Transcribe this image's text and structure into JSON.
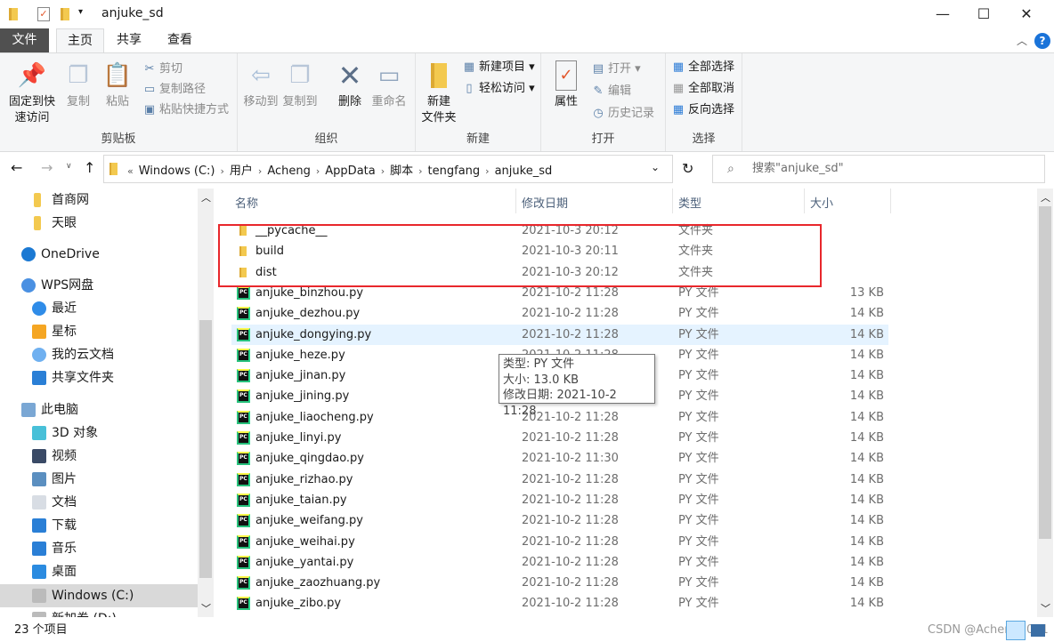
{
  "window": {
    "title": "anjuke_sd",
    "minimize": "—",
    "maximize": "☐",
    "close": "✕"
  },
  "ribbon_tabs": [
    "文件",
    "主页",
    "共享",
    "查看"
  ],
  "ribbon": {
    "clipboard": {
      "label": "剪贴板",
      "pin": "固定到快速访问",
      "copy": "复制",
      "paste": "粘贴",
      "cut": "剪切",
      "copy_path": "复制路径",
      "paste_shortcut": "粘贴快捷方式"
    },
    "organize": {
      "label": "组织",
      "move_to": "移动到",
      "copy_to": "复制到",
      "delete": "删除",
      "rename": "重命名"
    },
    "new": {
      "label": "新建",
      "new_folder": "新建\n文件夹",
      "new_item": "新建项目",
      "easy_access": "轻松访问"
    },
    "open": {
      "label": "打开",
      "properties": "属性",
      "open": "打开",
      "edit": "编辑",
      "history": "历史记录"
    },
    "select": {
      "label": "选择",
      "select_all": "全部选择",
      "select_none": "全部取消",
      "invert": "反向选择"
    }
  },
  "address": {
    "crumbs": [
      "Windows (C:)",
      "用户",
      "Acheng",
      "AppData",
      "脚本",
      "tengfang",
      "anjuke_sd"
    ],
    "search_placeholder": "搜索\"anjuke_sd\""
  },
  "nav": [
    {
      "label": "首商网",
      "icon": "folder-icon"
    },
    {
      "label": "天眼",
      "icon": "folder-icon"
    },
    {
      "label": "OneDrive",
      "icon": "cloud-icon"
    },
    {
      "label": "WPS网盘",
      "icon": "wps-cloud-icon"
    },
    {
      "label": "最近",
      "icon": "clock-icon"
    },
    {
      "label": "星标",
      "icon": "star-icon"
    },
    {
      "label": "我的云文档",
      "icon": "cloud-doc-icon"
    },
    {
      "label": "共享文件夹",
      "icon": "share-icon"
    },
    {
      "label": "此电脑",
      "icon": "computer-icon"
    },
    {
      "label": "3D 对象",
      "icon": "3d-icon"
    },
    {
      "label": "视频",
      "icon": "video-icon"
    },
    {
      "label": "图片",
      "icon": "picture-icon"
    },
    {
      "label": "文档",
      "icon": "document-icon"
    },
    {
      "label": "下载",
      "icon": "download-icon"
    },
    {
      "label": "音乐",
      "icon": "music-icon"
    },
    {
      "label": "桌面",
      "icon": "desktop-icon"
    },
    {
      "label": "Windows (C:)",
      "icon": "drive-icon"
    },
    {
      "label": "新加卷 (D:)",
      "icon": "drive-icon"
    }
  ],
  "columns": [
    "名称",
    "修改日期",
    "类型",
    "大小"
  ],
  "files": [
    {
      "name": "__pycache__",
      "date": "2021-10-3 20:12",
      "type": "文件夹",
      "size": "",
      "kind": "folder"
    },
    {
      "name": "build",
      "date": "2021-10-3 20:11",
      "type": "文件夹",
      "size": "",
      "kind": "folder"
    },
    {
      "name": "dist",
      "date": "2021-10-3 20:12",
      "type": "文件夹",
      "size": "",
      "kind": "folder"
    },
    {
      "name": "anjuke_binzhou.py",
      "date": "2021-10-2 11:28",
      "type": "PY 文件",
      "size": "13 KB",
      "kind": "py"
    },
    {
      "name": "anjuke_dezhou.py",
      "date": "2021-10-2 11:28",
      "type": "PY 文件",
      "size": "14 KB",
      "kind": "py"
    },
    {
      "name": "anjuke_dongying.py",
      "date": "2021-10-2 11:28",
      "type": "PY 文件",
      "size": "14 KB",
      "kind": "py"
    },
    {
      "name": "anjuke_heze.py",
      "date": "2021-10-2 11:28",
      "type": "PY 文件",
      "size": "14 KB",
      "kind": "py"
    },
    {
      "name": "anjuke_jinan.py",
      "date": "2021-10-2 11:28",
      "type": "PY 文件",
      "size": "14 KB",
      "kind": "py"
    },
    {
      "name": "anjuke_jining.py",
      "date": "2021-10-2 11:28",
      "type": "PY 文件",
      "size": "14 KB",
      "kind": "py"
    },
    {
      "name": "anjuke_liaocheng.py",
      "date": "2021-10-2 11:28",
      "type": "PY 文件",
      "size": "14 KB",
      "kind": "py"
    },
    {
      "name": "anjuke_linyi.py",
      "date": "2021-10-2 11:28",
      "type": "PY 文件",
      "size": "14 KB",
      "kind": "py"
    },
    {
      "name": "anjuke_qingdao.py",
      "date": "2021-10-2 11:30",
      "type": "PY 文件",
      "size": "14 KB",
      "kind": "py"
    },
    {
      "name": "anjuke_rizhao.py",
      "date": "2021-10-2 11:28",
      "type": "PY 文件",
      "size": "14 KB",
      "kind": "py"
    },
    {
      "name": "anjuke_taian.py",
      "date": "2021-10-2 11:28",
      "type": "PY 文件",
      "size": "14 KB",
      "kind": "py"
    },
    {
      "name": "anjuke_weifang.py",
      "date": "2021-10-2 11:28",
      "type": "PY 文件",
      "size": "14 KB",
      "kind": "py"
    },
    {
      "name": "anjuke_weihai.py",
      "date": "2021-10-2 11:28",
      "type": "PY 文件",
      "size": "14 KB",
      "kind": "py"
    },
    {
      "name": "anjuke_yantai.py",
      "date": "2021-10-2 11:28",
      "type": "PY 文件",
      "size": "14 KB",
      "kind": "py"
    },
    {
      "name": "anjuke_zaozhuang.py",
      "date": "2021-10-2 11:28",
      "type": "PY 文件",
      "size": "14 KB",
      "kind": "py"
    },
    {
      "name": "anjuke_zibo.py",
      "date": "2021-10-2 11:28",
      "type": "PY 文件",
      "size": "14 KB",
      "kind": "py"
    }
  ],
  "tooltip": {
    "type": "类型: PY 文件",
    "size": "大小: 13.0 KB",
    "modified": "修改日期: 2021-10-2 11:28"
  },
  "status": {
    "count": "23 个项目"
  },
  "watermark": "CSDN @Acheng1011",
  "colors": {
    "accent": "#0078d7",
    "highlight_row": "#e5f3ff",
    "red_box": "#e8272c",
    "file_tab": "#505050"
  }
}
